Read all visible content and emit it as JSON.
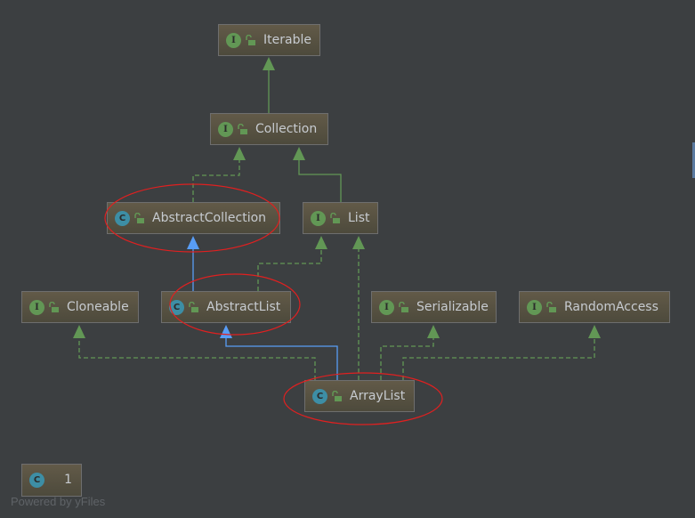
{
  "nodes": [
    {
      "id": "iterable",
      "label": "Iterable",
      "kind": "I"
    },
    {
      "id": "collection",
      "label": "Collection",
      "kind": "I"
    },
    {
      "id": "abstractcollection",
      "label": "AbstractCollection",
      "kind": "C"
    },
    {
      "id": "list",
      "label": "List",
      "kind": "I"
    },
    {
      "id": "cloneable",
      "label": "Cloneable",
      "kind": "I"
    },
    {
      "id": "abstractlist",
      "label": "AbstractList",
      "kind": "C"
    },
    {
      "id": "serializable",
      "label": "Serializable",
      "kind": "I"
    },
    {
      "id": "randomaccess",
      "label": "RandomAccess",
      "kind": "I"
    },
    {
      "id": "arraylist",
      "label": "ArrayList",
      "kind": "C"
    }
  ],
  "edges": [
    {
      "from": "Collection",
      "to": "Iterable",
      "type": "extends"
    },
    {
      "from": "AbstractCollection",
      "to": "Collection",
      "type": "implements"
    },
    {
      "from": "List",
      "to": "Collection",
      "type": "extends"
    },
    {
      "from": "AbstractList",
      "to": "AbstractCollection",
      "type": "extends-class"
    },
    {
      "from": "AbstractList",
      "to": "List",
      "type": "implements"
    },
    {
      "from": "ArrayList",
      "to": "List",
      "type": "implements"
    },
    {
      "from": "ArrayList",
      "to": "AbstractList",
      "type": "extends-class"
    },
    {
      "from": "ArrayList",
      "to": "Cloneable",
      "type": "implements"
    },
    {
      "from": "ArrayList",
      "to": "Serializable",
      "type": "implements"
    },
    {
      "from": "ArrayList",
      "to": "RandomAccess",
      "type": "implements"
    }
  ],
  "highlighted": [
    "AbstractCollection",
    "AbstractList",
    "ArrayList"
  ],
  "counter": {
    "badge": "C",
    "value": "1"
  },
  "footer": "Powered by yFiles",
  "colors": {
    "background": "#3c3f41",
    "interface_edge": "#629755",
    "class_edge": "#589df6",
    "highlight": "#e02020"
  }
}
